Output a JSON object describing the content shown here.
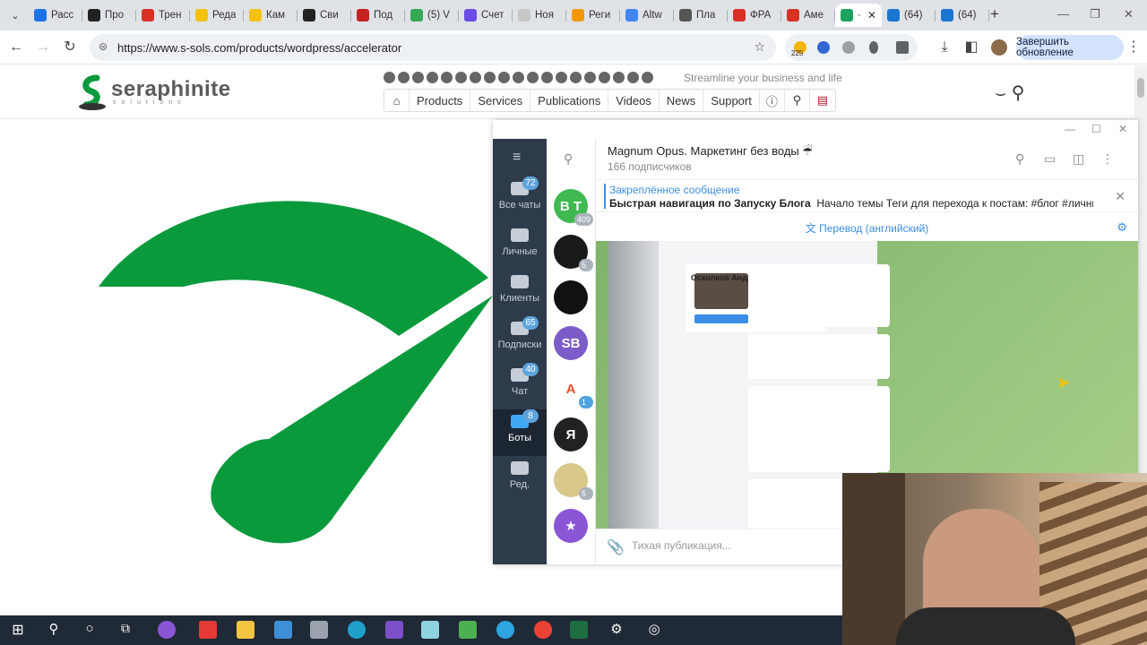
{
  "browser": {
    "tabs": [
      {
        "label": "Расс",
        "color": "#1a73e8"
      },
      {
        "label": "Про",
        "color": "#222222"
      },
      {
        "label": "Трен",
        "color": "#d93025"
      },
      {
        "label": "Реда",
        "color": "#f4c20d"
      },
      {
        "label": "Кам",
        "color": "#f4c20d"
      },
      {
        "label": "Сви",
        "color": "#222222"
      },
      {
        "label": "Под",
        "color": "#c5221f"
      },
      {
        "label": "(5) V",
        "color": "#34a853"
      },
      {
        "label": "Счет",
        "color": "#6b4ce6"
      },
      {
        "label": "Ноя",
        "color": "#c7c7c7"
      },
      {
        "label": "Реги",
        "color": "#f29900"
      },
      {
        "label": "Altw",
        "color": "#4285f4"
      },
      {
        "label": "Пла",
        "color": "#555555"
      },
      {
        "label": "ФРА",
        "color": "#d93025"
      },
      {
        "label": "Аме",
        "color": "#d93025"
      },
      {
        "label": "·",
        "color": "#1aa260",
        "active": true
      },
      {
        "label": "(64)",
        "color": "#1976d2"
      },
      {
        "label": "(64)",
        "color": "#1976d2"
      }
    ],
    "url": "https://www.s-sols.com/products/wordpress/accelerator",
    "extension_count": "225",
    "update_button": "Завершить обновление"
  },
  "site": {
    "logo_text": "seraphinite",
    "logo_sub": "solutions",
    "tagline": "Streamline your business and life",
    "nav": [
      "Products",
      "Services",
      "Publications",
      "Videos",
      "News",
      "Support"
    ],
    "icon_color": "#0a9a3c"
  },
  "telegram": {
    "folders": [
      {
        "label": "Все чаты",
        "badge": "72"
      },
      {
        "label": "Личные",
        "badge": ""
      },
      {
        "label": "Клиенты",
        "badge": ""
      },
      {
        "label": "Подписки",
        "badge": "65"
      },
      {
        "label": "Чат",
        "badge": "40"
      },
      {
        "label": "Боты",
        "badge": "8",
        "active": true
      },
      {
        "label": "Ред.",
        "badge": ""
      }
    ],
    "chat_avatars": [
      {
        "text": "B T",
        "color": "#3fb950",
        "badge": "409"
      },
      {
        "text": "",
        "color": "#1a1a1a",
        "badge": "5"
      },
      {
        "text": "",
        "color": "#111111",
        "badge": ""
      },
      {
        "text": "SB",
        "color": "#7b5cc9",
        "badge": ""
      },
      {
        "text": "A",
        "color": "#ffffff",
        "badge": "1",
        "badge_blue": true
      },
      {
        "text": "Я",
        "color": "#222222",
        "badge": ""
      },
      {
        "text": "",
        "color": "#d8c88a",
        "badge": "5"
      },
      {
        "text": "★",
        "color": "#8a56d6",
        "badge": ""
      }
    ],
    "channel_title": "Magnum Opus. Маркетинг без воды ☔",
    "channel_subscribers": "166 подписчиков",
    "pinned_title": "Закреплённое сообщение",
    "pinned_bold": "Быстрая навигация по Запуску Блога",
    "pinned_rest": "Начало темы  Теги для перехода к постам:  #блог #личныйбл...",
    "translate_label": "Перевод (английский)",
    "post_person_name": "Осколков Андрей",
    "input_placeholder": "Тихая публикация..."
  }
}
